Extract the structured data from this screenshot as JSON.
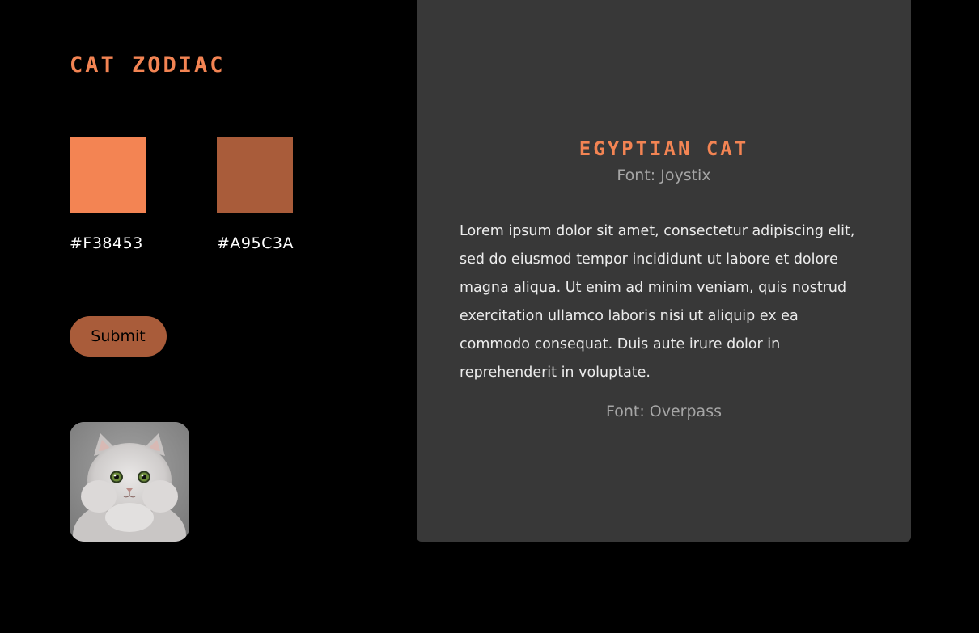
{
  "app": {
    "title": "Cat Zodiac"
  },
  "palette": {
    "swatches": [
      {
        "hex": "#F38453",
        "color": "#F38453"
      },
      {
        "hex": "#A95C3A",
        "color": "#A95C3A"
      }
    ]
  },
  "form": {
    "submit_label": "Submit"
  },
  "avatar": {
    "icon": "persian-cat-photo"
  },
  "card": {
    "title": "Egyptian Cat",
    "title_font_note": "Font: Joystix",
    "body": "Lorem ipsum dolor sit amet, consectetur adipiscing elit, sed do eiusmod tempor incididunt ut labore et dolore magna aliqua. Ut enim ad minim veniam, quis nostrud exercitation ullamco laboris nisi ut aliquip ex ea commodo consequat. Duis aute irure dolor in reprehenderit in voluptate.",
    "body_font_note": "Font: Overpass"
  },
  "colors": {
    "background": "#000000",
    "card_background": "#383838",
    "accent": "#F38453",
    "accent_dark": "#A95C3A"
  }
}
